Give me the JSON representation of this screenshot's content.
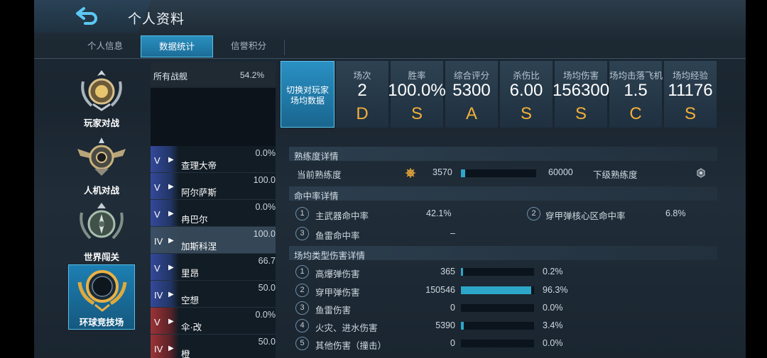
{
  "header": {
    "title": "个人资料"
  },
  "tabs": [
    {
      "label": "个人信息",
      "active": false
    },
    {
      "label": "数据统计",
      "active": true
    },
    {
      "label": "信誉积分",
      "active": false
    }
  ],
  "modes": [
    {
      "label": "玩家对战",
      "icon": "laurel-emblem-icon",
      "active": false
    },
    {
      "label": "人机对战",
      "icon": "winged-emblem-icon",
      "active": false
    },
    {
      "label": "世界闯关",
      "icon": "compass-emblem-icon",
      "active": false
    },
    {
      "label": "环球竞技场",
      "icon": "globe-emblem-icon",
      "active": true
    }
  ],
  "ships": {
    "all_label": "所有战舰",
    "all_value": "54.2%",
    "items": [
      {
        "tier": "V",
        "cls": "▶",
        "name": "查理大帝",
        "value": "0.0%",
        "nation": "blue"
      },
      {
        "tier": "V",
        "cls": "▶",
        "name": "阿尔萨斯",
        "value": "100.0",
        "nation": "blue"
      },
      {
        "tier": "V",
        "cls": "▶",
        "name": "冉巴尔",
        "value": "0.0%",
        "nation": "blue"
      },
      {
        "tier": "IV",
        "cls": "▶",
        "name": "加斯科涅",
        "value": "100.0",
        "nation": "blue",
        "selected": true
      },
      {
        "tier": "V",
        "cls": "▶",
        "name": "里昂",
        "value": "66.7",
        "nation": "blue"
      },
      {
        "tier": "IV",
        "cls": "▶",
        "name": "空想",
        "value": "50.0",
        "nation": "blue"
      },
      {
        "tier": "V",
        "cls": "▶",
        "name": "伞·改",
        "value": "0.0%",
        "nation": "red"
      },
      {
        "tier": "IV",
        "cls": "▶",
        "name": "橙",
        "value": "50.0",
        "nation": "red"
      }
    ]
  },
  "switch_button": "切换对玩家场均数据",
  "stat_cards": [
    {
      "label": "场次",
      "value": "2",
      "grade": "D"
    },
    {
      "label": "胜率",
      "value": "100.0%",
      "grade": "S"
    },
    {
      "label": "综合评分",
      "value": "5300",
      "grade": "A"
    },
    {
      "label": "杀伤比",
      "value": "6.00",
      "grade": "S"
    },
    {
      "label": "场均伤害",
      "value": "156300",
      "grade": "S"
    },
    {
      "label": "场均击落飞机",
      "value": "1.5",
      "grade": "C"
    },
    {
      "label": "场均经验",
      "value": "11176",
      "grade": "S"
    }
  ],
  "proficiency": {
    "section_title": "熟练度详情",
    "current_label": "当前熟练度",
    "current_value": "3570",
    "max_value": "60000",
    "progress": 0.06,
    "next_label": "下级熟练度",
    "icon_current": "helm-wheel-icon",
    "icon_next": "rank-badge-icon"
  },
  "accuracy": {
    "section_title": "命中率详情",
    "rows": [
      {
        "num": "1",
        "label": "主武器命中率",
        "value": "42.1%"
      },
      {
        "num": "2",
        "label": "穿甲弹核心区命中率",
        "value": "6.8%"
      },
      {
        "num": "3",
        "label": "鱼雷命中率",
        "value": "–"
      }
    ]
  },
  "damage": {
    "section_title": "场均类型伤害详情",
    "rows": [
      {
        "num": "1",
        "label": "高爆弹伤害",
        "value": "365",
        "percent": "0.2%",
        "fraction": 0.002
      },
      {
        "num": "2",
        "label": "穿甲弹伤害",
        "value": "150546",
        "percent": "96.3%",
        "fraction": 0.963
      },
      {
        "num": "3",
        "label": "鱼雷伤害",
        "value": "0",
        "percent": "0.0%",
        "fraction": 0
      },
      {
        "num": "4",
        "label": "火灾、进水伤害",
        "value": "5390",
        "percent": "3.4%",
        "fraction": 0.034
      },
      {
        "num": "5",
        "label": "其他伤害（撞击）",
        "value": "0",
        "percent": "0.0%",
        "fraction": 0
      }
    ]
  },
  "colors": {
    "accent": "#2a90c4",
    "grade": "#f2b038",
    "bar": "#2ca7c9"
  }
}
